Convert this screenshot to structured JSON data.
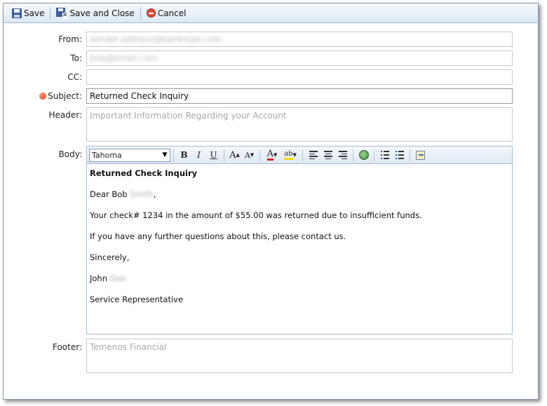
{
  "toolbar": {
    "save_label": "Save",
    "save_close_label": "Save and Close",
    "cancel_label": "Cancel"
  },
  "form": {
    "from_label": "From:",
    "from_value": "sender.address@bankmail.com",
    "to_label": "To:",
    "to_value": "bob@email.com",
    "cc_label": "CC:",
    "cc_value": "",
    "subject_label": "Subject:",
    "subject_value": "Returned Check Inquiry",
    "header_label": "Header:",
    "header_value": "Important Information Regarding your Account",
    "body_label": "Body:",
    "footer_label": "Footer:",
    "footer_value": "Temenos Financial"
  },
  "editor": {
    "font_value": "Tahoma",
    "icons": [
      "bold-icon",
      "italic-icon",
      "underline-icon",
      "font-size-increase-icon",
      "font-size-decrease-icon",
      "font-color-icon",
      "highlight-color-icon",
      "align-left-icon",
      "align-center-icon",
      "align-right-icon",
      "insert-image-icon",
      "numbered-list-icon",
      "bulleted-list-icon",
      "edit-source-icon"
    ],
    "body": {
      "title": "Returned Check Inquiry",
      "greeting": "Dear Bob",
      "greeting_blurred": "Smith",
      "line1": "Your check# 1234 in the amount of $55.00 was returned due to insufficient funds.",
      "line2": "If you have any further questions about this, please contact us.",
      "closing": "Sincerely,",
      "signature_first": "John",
      "signature_blurred": "Doe",
      "signature_title": "Service Representative"
    }
  },
  "colors": {
    "required": "#d6441a",
    "font_color_underline": "#e01b1b",
    "highlight_underline": "#f0e000"
  }
}
